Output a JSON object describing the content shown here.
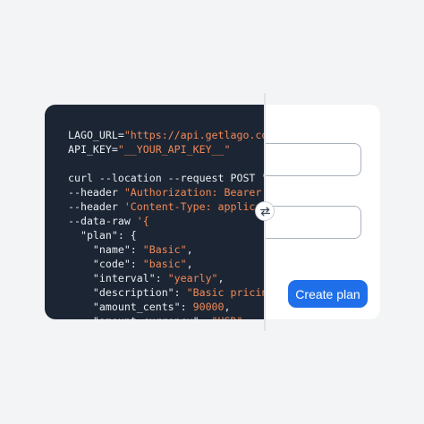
{
  "code": {
    "lines": [
      [
        {
          "t": "LAGO_URL=",
          "c": "plain"
        },
        {
          "t": "\"https://api.getlago.com",
          "c": "str"
        }
      ],
      [
        {
          "t": "API_KEY=",
          "c": "plain"
        },
        {
          "t": "\"__YOUR_API_KEY__\"",
          "c": "str"
        }
      ],
      [
        {
          "t": "",
          "c": "plain"
        }
      ],
      [
        {
          "t": "curl --location --request POST ",
          "c": "plain"
        },
        {
          "t": "\"$",
          "c": "str"
        }
      ],
      [
        {
          "t": "--header ",
          "c": "plain"
        },
        {
          "t": "\"Authorization: Bearer $",
          "c": "str"
        }
      ],
      [
        {
          "t": "--header ",
          "c": "plain"
        },
        {
          "t": "'Content-Type: applicat",
          "c": "str"
        }
      ],
      [
        {
          "t": "--data-raw ",
          "c": "plain"
        },
        {
          "t": "'{",
          "c": "str"
        }
      ],
      [
        {
          "t": "  \"plan\": {",
          "c": "plain"
        }
      ],
      [
        {
          "t": "    \"name\": ",
          "c": "plain"
        },
        {
          "t": "\"Basic\"",
          "c": "str"
        },
        {
          "t": ",",
          "c": "plain"
        }
      ],
      [
        {
          "t": "    \"code\": ",
          "c": "plain"
        },
        {
          "t": "\"basic\"",
          "c": "str"
        },
        {
          "t": ",",
          "c": "plain"
        }
      ],
      [
        {
          "t": "    \"interval\": ",
          "c": "plain"
        },
        {
          "t": "\"yearly\"",
          "c": "str"
        },
        {
          "t": ",",
          "c": "plain"
        }
      ],
      [
        {
          "t": "    \"description\": ",
          "c": "plain"
        },
        {
          "t": "\"Basic pricing",
          "c": "str"
        }
      ],
      [
        {
          "t": "    \"amount_cents\": ",
          "c": "plain"
        },
        {
          "t": "90000",
          "c": "str"
        },
        {
          "t": ",",
          "c": "plain"
        }
      ],
      [
        {
          "t": "    \"amount_currency\": ",
          "c": "plain"
        },
        {
          "t": "\"USD\"",
          "c": "str"
        }
      ]
    ]
  },
  "form": {
    "field_1_value": "",
    "field_2_value": "",
    "create_button_label": "Create plan"
  },
  "swap_handle": {
    "icon": "swap-arrows-icon"
  },
  "colors": {
    "code_bg": "#1c2533",
    "string": "#f08a57",
    "button": "#1f6feb"
  }
}
